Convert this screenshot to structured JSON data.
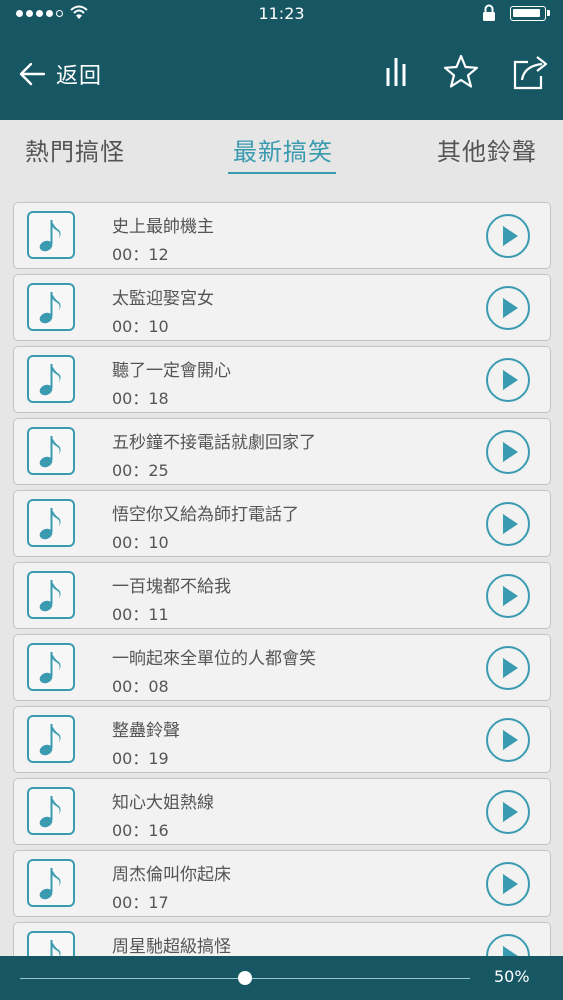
{
  "status_bar": {
    "time": "11:23"
  },
  "header": {
    "back_label": "返回"
  },
  "tabs": [
    {
      "label": "熱門搞怪"
    },
    {
      "label": "最新搞笑"
    },
    {
      "label": "其他鈴聲"
    }
  ],
  "active_tab": "最新搞笑",
  "ringtones": [
    {
      "title": "史上最帥機主",
      "duration": "00：12"
    },
    {
      "title": "太監迎娶宮女",
      "duration": "00：10"
    },
    {
      "title": "聽了一定會開心",
      "duration": "00：18"
    },
    {
      "title": "五秒鐘不接電話就劇回家了",
      "duration": "00：25"
    },
    {
      "title": "悟空你又給為師打電話了",
      "duration": "00：10"
    },
    {
      "title": "一百塊都不給我",
      "duration": "00：11"
    },
    {
      "title": "一晌起來全單位的人都會笑",
      "duration": "00：08"
    },
    {
      "title": "整蠱鈴聲",
      "duration": "00：19"
    },
    {
      "title": "知心大姐熱線",
      "duration": "00：16"
    },
    {
      "title": "周杰倫叫你起床",
      "duration": "00：17"
    },
    {
      "title": "周星馳超級搞怪",
      "duration": ""
    }
  ],
  "volume": {
    "label": "50%",
    "value": 0.5
  },
  "colors": {
    "header_bg": "#175764",
    "accent": "#3a9bb0",
    "background": "#e6e6e6"
  },
  "icons": [
    "back-arrow-icon",
    "equalizer-icon",
    "star-icon",
    "share-icon",
    "music-note-icon",
    "play-icon"
  ]
}
